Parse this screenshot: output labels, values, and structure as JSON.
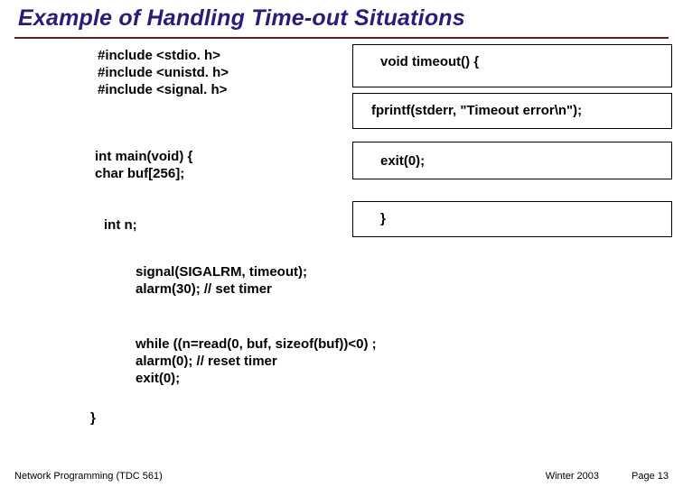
{
  "title": "Example of Handling Time-out Situations",
  "code": {
    "includes": "#include <stdio. h>\n#include <unistd. h>\n#include <signal. h>",
    "main_decl": "int main(void) {\nchar buf[256];",
    "int_n": "int n;",
    "signal_block": "signal(SIGALRM, timeout);\nalarm(30); // set timer",
    "while_block": "while ((n=read(0, buf, sizeof(buf))<0) ;\nalarm(0); // reset timer\nexit(0);",
    "closing_brace": "}"
  },
  "box": {
    "timeout_decl": "void timeout() {",
    "fprintf": "fprintf(stderr, \"Timeout error\\n\");",
    "exit": "exit(0);",
    "close": "}"
  },
  "footer": {
    "left": "Network Programming (TDC 561)",
    "term": "Winter 2003",
    "page": "Page 13"
  }
}
